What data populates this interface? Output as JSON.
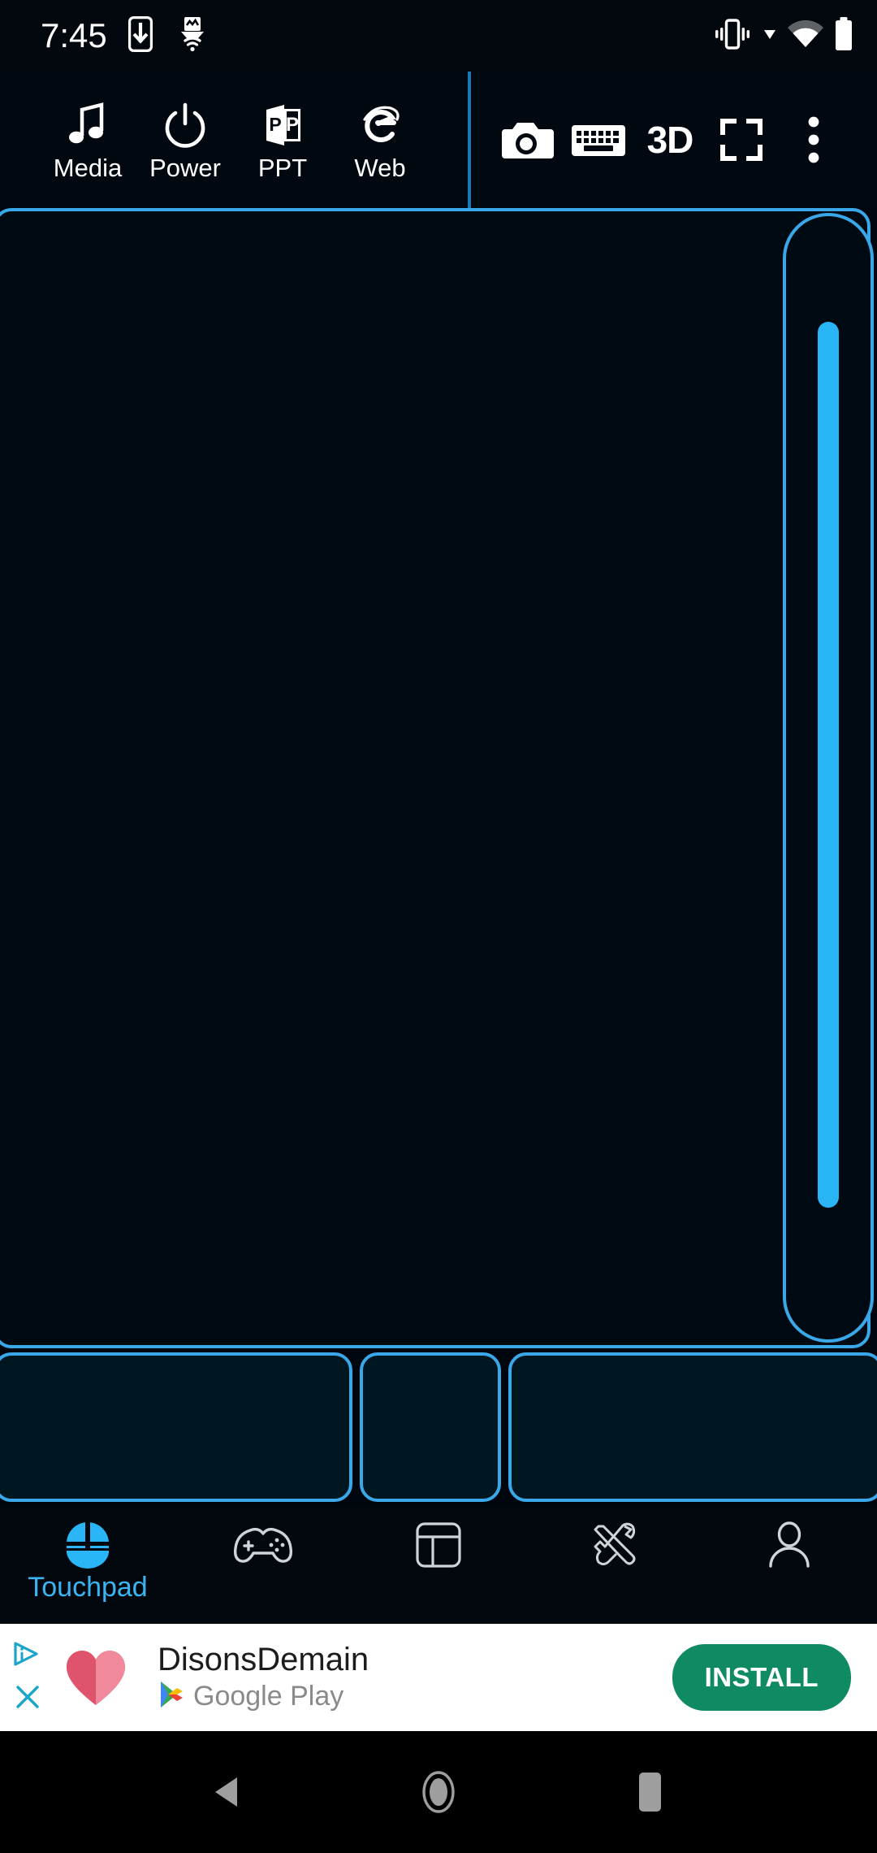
{
  "status_bar": {
    "time": "7:45",
    "left_icons": [
      "phone-download-icon",
      "wifi-transfer-icon"
    ],
    "right_icons": [
      "vibrate-icon",
      "dropdown-caret-icon",
      "wifi-signal-icon",
      "battery-full-icon"
    ]
  },
  "toolbar": {
    "shortcuts": [
      {
        "label": "Media",
        "icon": "music-note-icon"
      },
      {
        "label": "Power",
        "icon": "power-icon"
      },
      {
        "label": "PPT",
        "icon": "powerpoint-icon"
      },
      {
        "label": "Web",
        "icon": "internet-explorer-icon"
      }
    ],
    "actions": [
      {
        "name": "camera-icon",
        "label": ""
      },
      {
        "name": "keyboard-icon",
        "label": ""
      },
      {
        "name": "three-d-icon",
        "label": "3D"
      },
      {
        "name": "fullscreen-icon",
        "label": ""
      },
      {
        "name": "overflow-menu-icon",
        "label": ""
      }
    ]
  },
  "touchpad": {
    "label": "touchpad-surface",
    "scrollbar": {
      "name": "vertical-scrollbar",
      "thumb": "scrollbar-thumb"
    }
  },
  "mouse_buttons": [
    {
      "name": "left-click-button"
    },
    {
      "name": "middle-click-button"
    },
    {
      "name": "right-click-button"
    }
  ],
  "bottom_nav": {
    "active": "Touchpad",
    "items": [
      {
        "label": "Touchpad",
        "icon": "mouse-icon",
        "active": true
      },
      {
        "label": "",
        "icon": "gamepad-icon",
        "active": false
      },
      {
        "label": "",
        "icon": "layout-panels-icon",
        "active": false
      },
      {
        "label": "",
        "icon": "tools-icon",
        "active": false
      },
      {
        "label": "",
        "icon": "profile-person-icon",
        "active": false
      }
    ]
  },
  "ad": {
    "title": "DisonsDemain",
    "store": "Google Play",
    "install_label": "INSTALL",
    "adchoices_icon": "adchoices-icon",
    "close_icon": "close-icon",
    "app_icon": "heart-logo-icon"
  },
  "system_nav": {
    "back": "back-button",
    "home": "home-button",
    "recents": "recents-button"
  },
  "colors": {
    "accent_blue": "#3aa8e8",
    "thumb_blue": "#29b5f6",
    "nav_active": "#3ab4f2",
    "install_green": "#0f8a63",
    "background": "#00060d",
    "touchpad_fill": "#000a12",
    "button_fill": "#001620"
  }
}
